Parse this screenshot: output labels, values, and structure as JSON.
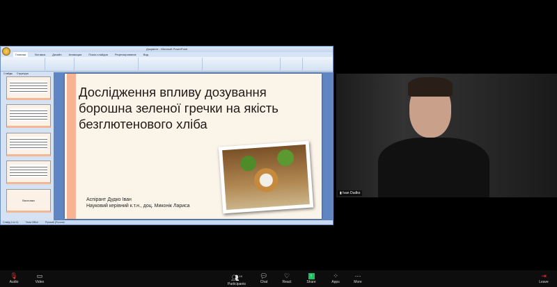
{
  "powerpoint": {
    "window_title": "Документ - Microsoft PowerPoint",
    "tabs": [
      "Главная",
      "Вставка",
      "Дизайн",
      "Анимация",
      "Показ слайдов",
      "Рецензирование",
      "Вид"
    ],
    "sidebar_tabs": [
      "Слайды",
      "Структура"
    ],
    "last_thumb_label": "Висновки",
    "slide": {
      "title": "Дослідження впливу дозування борошна зеленої гречки на якість безглютенового хліба",
      "author_line1": "Аспірант Дудко Іван",
      "author_line2": "Науковий керівний к.т.н., доц. Миконік Лариса"
    },
    "status": [
      "Слайд 1 из 11",
      "Тема Office",
      "Русский (Россия)"
    ]
  },
  "video": {
    "participant_name": "Ivan Dudko"
  },
  "toolbar": {
    "audio": "Audio",
    "video": "Video",
    "participants": "Participants",
    "participants_count": "19",
    "chat": "Chat",
    "react": "React",
    "share": "Share",
    "apps": "Apps",
    "more": "More",
    "leave": "Leave"
  }
}
